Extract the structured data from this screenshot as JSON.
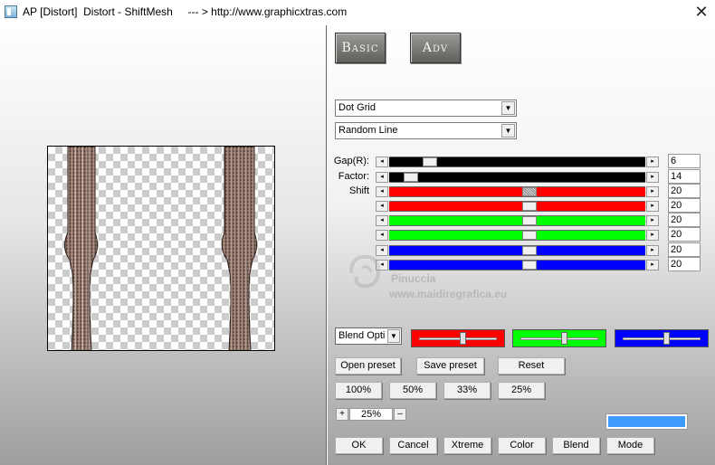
{
  "window": {
    "title": "AP [Distort]  Distort - ShiftMesh     --- > http://www.graphicxtras.com",
    "close_glyph": "✕"
  },
  "tabs": [
    {
      "label": "Basic"
    },
    {
      "label": "Adv"
    }
  ],
  "dropdowns": {
    "pattern": "Dot Grid",
    "line": "Random Line"
  },
  "sliders": [
    {
      "label": "Gap(R):",
      "value": "6",
      "fraction": 0.14,
      "color": "#000000",
      "hatched": false
    },
    {
      "label": "Factor:",
      "value": "14",
      "fraction": 0.06,
      "color": "#000000",
      "hatched": false
    },
    {
      "label": "Shift",
      "value": "20",
      "fraction": 0.55,
      "color": "#ff0000",
      "hatched": true
    },
    {
      "label": "",
      "value": "20",
      "fraction": 0.55,
      "color": "#ff0000",
      "hatched": false
    },
    {
      "label": "",
      "value": "20",
      "fraction": 0.55,
      "color": "#00ff00",
      "hatched": false
    },
    {
      "label": "",
      "value": "20",
      "fraction": 0.55,
      "color": "#00ff00",
      "hatched": false
    },
    {
      "label": "",
      "value": "20",
      "fraction": 0.55,
      "color": "#0000ff",
      "hatched": false
    },
    {
      "label": "",
      "value": "20",
      "fraction": 0.55,
      "color": "#0000ff",
      "hatched": false
    }
  ],
  "watermark": {
    "line1": "Pinuccia",
    "line2": "www.maidiregrafica.eu"
  },
  "blend": {
    "selected": "Blend Options"
  },
  "color_panels": [
    {
      "color": "#ff0000",
      "fraction": 0.55
    },
    {
      "color": "#00ff00",
      "fraction": 0.55
    },
    {
      "color": "#0000ff",
      "fraction": 0.55
    }
  ],
  "preset_buttons": {
    "open": "Open preset",
    "save": "Save preset",
    "reset": "Reset"
  },
  "zoom_buttons": [
    "100%",
    "50%",
    "33%",
    "25%"
  ],
  "zoom": {
    "plus": "+",
    "value": "25%",
    "minus": "–"
  },
  "swatch_color": "#3d9bff",
  "action_buttons": {
    "ok": "OK",
    "cancel": "Cancel",
    "xtreme": "Xtreme",
    "color": "Color",
    "blend": "Blend",
    "mode": "Mode"
  }
}
